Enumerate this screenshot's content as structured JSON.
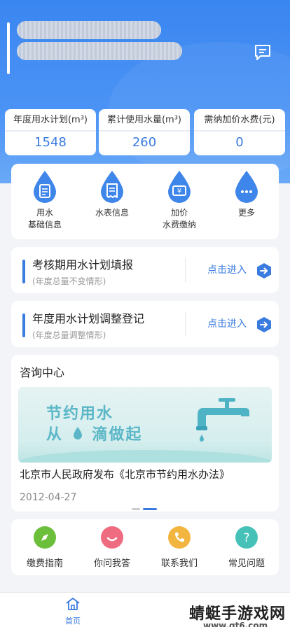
{
  "stats": [
    {
      "label": "年度用水计划(m³)",
      "value": "1548"
    },
    {
      "label": "累计使用水量(m³)",
      "value": "260"
    },
    {
      "label": "需纳加价水费(元)",
      "value": "0"
    }
  ],
  "menu": [
    {
      "label_line1": "用水",
      "label_line2": "基础信息",
      "icon": "document-drop-icon"
    },
    {
      "label_line1": "水表信息",
      "label_line2": "",
      "icon": "receipt-drop-icon"
    },
    {
      "label_line1": "加价",
      "label_line2": "水费缴纳",
      "icon": "yen-ticket-drop-icon"
    },
    {
      "label_line1": "更多",
      "label_line2": "",
      "icon": "more-drop-icon"
    }
  ],
  "tasks": [
    {
      "title": "考核期用水计划填报",
      "subtitle": "(年度总量不变情形)",
      "link": "点击进入"
    },
    {
      "title": "年度用水计划调整登记",
      "subtitle": "(年度总量调整情形)",
      "link": "点击进入"
    }
  ],
  "news": {
    "section_title": "咨询中心",
    "banner_line1": "节约用水",
    "banner_line2_a": "从",
    "banner_line2_b": "滴做起",
    "headline": "北京市人民政府发布《北京市节约用水办法》",
    "date": "2012-04-27"
  },
  "quick": [
    {
      "label": "缴费指南",
      "icon": "compass-icon",
      "color": "#6cbf3a"
    },
    {
      "label": "你问我答",
      "icon": "smile-icon",
      "color": "#ef6b80"
    },
    {
      "label": "联系我们",
      "icon": "phone-icon",
      "color": "#f2b540"
    },
    {
      "label": "常见问题",
      "icon": "question-icon",
      "color": "#46c1b8"
    }
  ],
  "tabbar": {
    "home_label": "首页"
  },
  "watermark": {
    "text": "蜻蜓手游戏网",
    "url": "www.qt6.com"
  },
  "colors": {
    "primary": "#3a7be0",
    "header": "#3a86f0"
  }
}
